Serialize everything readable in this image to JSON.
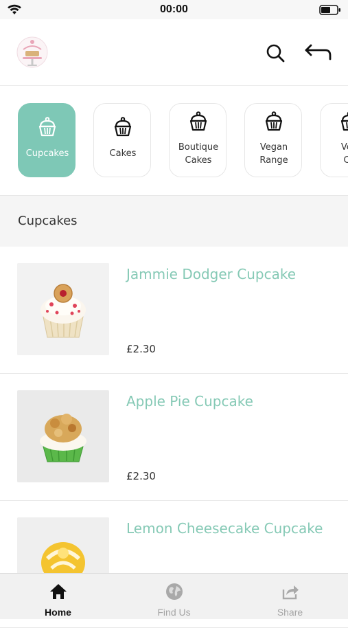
{
  "status_bar": {
    "time": "00:00"
  },
  "header": {
    "logo_icon": "cake-shop-logo",
    "search_icon": "search-icon",
    "back_icon": "back-arrow-icon"
  },
  "categories": [
    {
      "label": "Cupcakes",
      "icon": "cupcake-icon",
      "active": true
    },
    {
      "label": "Cakes",
      "icon": "cupcake-icon",
      "active": false
    },
    {
      "label": "Boutique Cakes",
      "line1": "Boutique",
      "line2": "Cakes",
      "icon": "cupcake-icon",
      "active": false
    },
    {
      "label": "Vegan Range",
      "line1": "Vegan",
      "line2": "Range",
      "icon": "cupcake-icon",
      "active": false
    },
    {
      "label": "Vegan Cakes (partially visible)",
      "line1": "Veg",
      "line2": "Ca",
      "icon": "cupcake-icon",
      "active": false
    }
  ],
  "section": {
    "title": "Cupcakes"
  },
  "products": [
    {
      "name": "Jammie Dodger Cupcake",
      "price": "£2.30"
    },
    {
      "name": "Apple Pie Cupcake",
      "price": "£2.30"
    },
    {
      "name": "Lemon Cheesecake Cupcake",
      "price": ""
    }
  ],
  "tabbar": {
    "items": [
      {
        "label": "Home",
        "icon": "home-icon",
        "active": true
      },
      {
        "label": "Find Us",
        "icon": "globe-icon",
        "active": false
      },
      {
        "label": "Share",
        "icon": "share-icon",
        "active": false
      }
    ]
  },
  "colors": {
    "accent": "#7ec8b6",
    "product_name": "#85c9b5"
  }
}
